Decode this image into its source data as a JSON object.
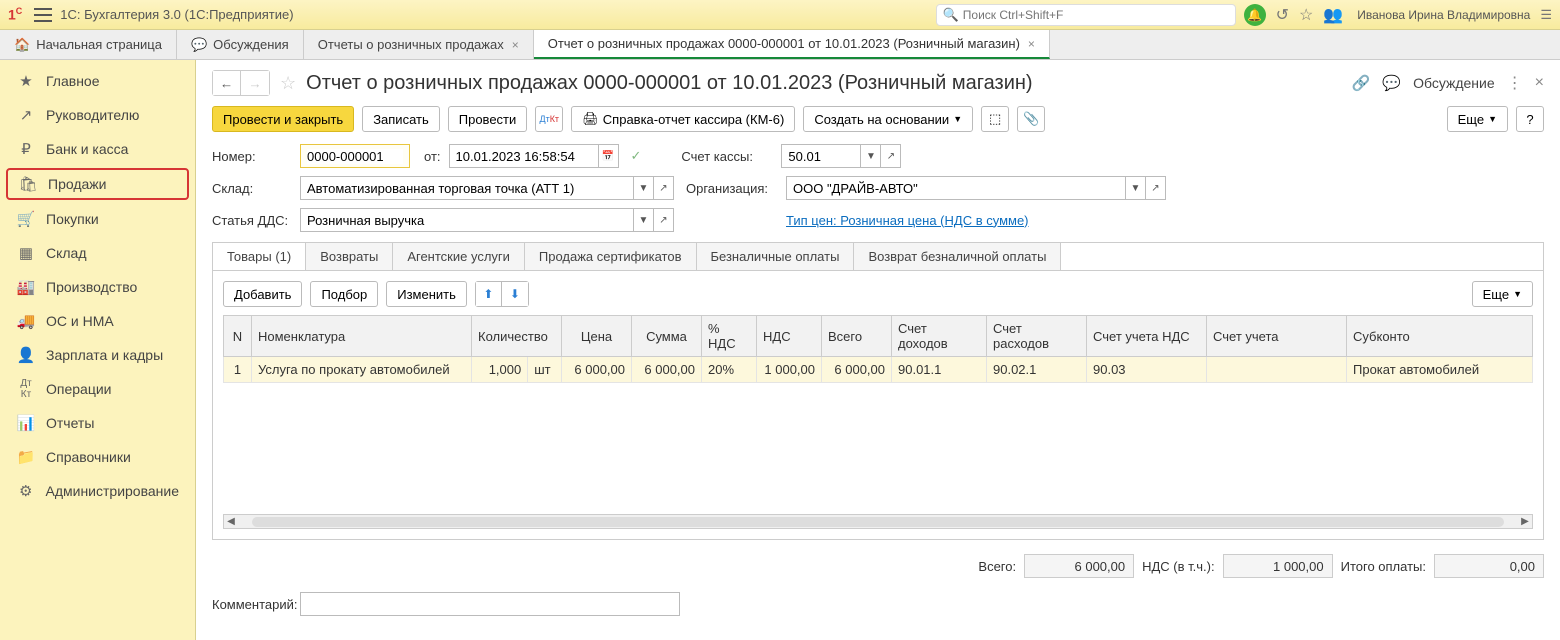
{
  "header": {
    "app_title": "1С: Бухгалтерия 3.0  (1С:Предприятие)",
    "search_placeholder": "Поиск Ctrl+Shift+F",
    "user_name": "Иванова Ирина Владимировна"
  },
  "tabs": {
    "home": "Начальная страница",
    "t1": "Обсуждения",
    "t2": "Отчеты о розничных продажах",
    "t3": "Отчет о розничных продажах 0000-000001 от 10.01.2023 (Розничный магазин)"
  },
  "sidebar": {
    "items": [
      "Главное",
      "Руководителю",
      "Банк и касса",
      "Продажи",
      "Покупки",
      "Склад",
      "Производство",
      "ОС и НМА",
      "Зарплата и кадры",
      "Операции",
      "Отчеты",
      "Справочники",
      "Администрирование"
    ]
  },
  "page": {
    "title": "Отчет о розничных продажах 0000-000001 от 10.01.2023 (Розничный магазин)",
    "discuss": "Обсуждение"
  },
  "toolbar": {
    "post_close": "Провести и закрыть",
    "save": "Записать",
    "post": "Провести",
    "report": "Справка-отчет кассира (КМ-6)",
    "create_based": "Создать на основании",
    "more": "Еще"
  },
  "form": {
    "number_lbl": "Номер:",
    "number_val": "0000-000001",
    "from_lbl": "от:",
    "date_val": "10.01.2023 16:58:54",
    "account_lbl": "Счет кассы:",
    "account_val": "50.01",
    "warehouse_lbl": "Склад:",
    "warehouse_val": "Автоматизированная торговая точка (АТТ 1)",
    "org_lbl": "Организация:",
    "org_val": "ООО \"ДРАЙВ-АВТО\"",
    "dds_lbl": "Статья ДДС:",
    "dds_val": "Розничная выручка",
    "price_type": "Тип цен: Розничная цена (НДС в сумме)",
    "comment_lbl": "Комментарий:",
    "comment_val": ""
  },
  "subtabs": {
    "t0": "Товары (1)",
    "t1": "Возвраты",
    "t2": "Агентские услуги",
    "t3": "Продажа сертификатов",
    "t4": "Безналичные оплаты",
    "t5": "Возврат безналичной оплаты"
  },
  "subtool": {
    "add": "Добавить",
    "pick": "Подбор",
    "edit": "Изменить",
    "more": "Еще"
  },
  "table": {
    "headers": {
      "n": "N",
      "nom": "Номенклатура",
      "qty": "Количество",
      "unit": "",
      "price": "Цена",
      "sum": "Сумма",
      "vatpct": "% НДС",
      "vat": "НДС",
      "total": "Всего",
      "income": "Счет доходов",
      "expense": "Счет расходов",
      "vatacc": "Счет учета НДС",
      "acc": "Счет учета",
      "subconto": "Субконто"
    },
    "row": {
      "n": "1",
      "nom": "Услуга по прокату автомобилей",
      "qty": "1,000",
      "unit": "шт",
      "price": "6 000,00",
      "sum": "6 000,00",
      "vatpct": "20%",
      "vat": "1 000,00",
      "total": "6 000,00",
      "income": "90.01.1",
      "expense": "90.02.1",
      "vatacc": "90.03",
      "acc": "",
      "subconto": "Прокат автомобилей"
    }
  },
  "totals": {
    "total_lbl": "Всего:",
    "total_val": "6 000,00",
    "vat_lbl": "НДС (в т.ч.):",
    "vat_val": "1 000,00",
    "pay_lbl": "Итого оплаты:",
    "pay_val": "0,00"
  }
}
